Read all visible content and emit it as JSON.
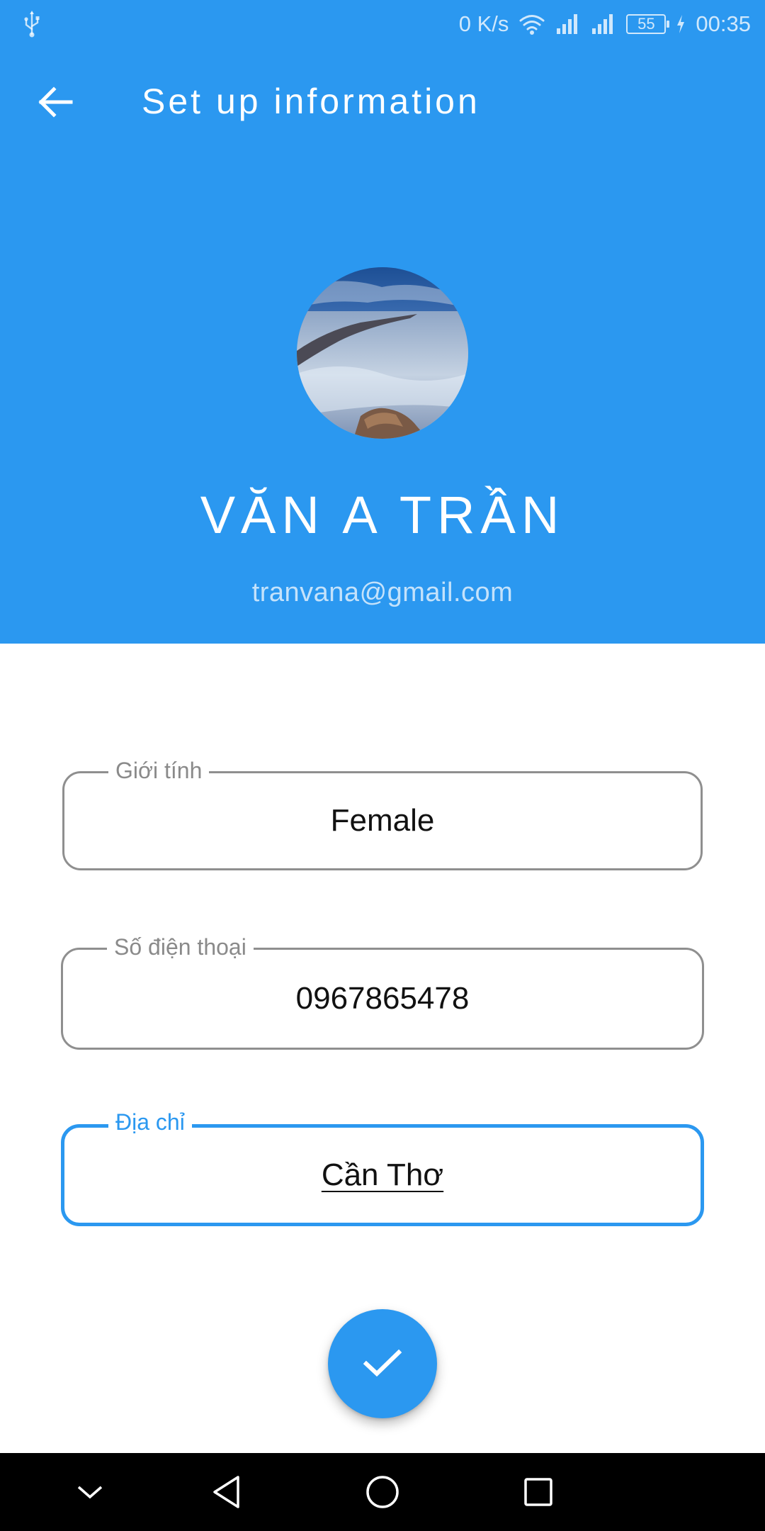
{
  "status_bar": {
    "net_speed": "0 K/s",
    "battery": "55",
    "time": "00:35",
    "icons": [
      "usb-icon",
      "wifi-icon",
      "signal-icon",
      "signal-icon",
      "battery-icon",
      "charging-icon"
    ]
  },
  "toolbar": {
    "title": "Set up information",
    "back_icon": "arrow-left-icon"
  },
  "profile": {
    "name": "VĂN A TRẦN",
    "email": "tranvana@gmail.com",
    "avatar": "seascape-photo"
  },
  "form": {
    "gender": {
      "label": "Giới tính",
      "value": "Female"
    },
    "phone": {
      "label": "Số điện thoại",
      "value": "0967865478"
    },
    "address": {
      "label": "Địa chỉ",
      "value": "Cần Thơ"
    }
  },
  "fab": {
    "icon": "check-icon"
  },
  "nav_bar": {
    "icons": [
      "chevron-down-icon",
      "back-triangle-icon",
      "home-circle-icon",
      "recents-square-icon"
    ]
  },
  "colors": {
    "primary": "#2b98f0",
    "outline": "#8f8f8f",
    "nav_background": "#000000"
  }
}
